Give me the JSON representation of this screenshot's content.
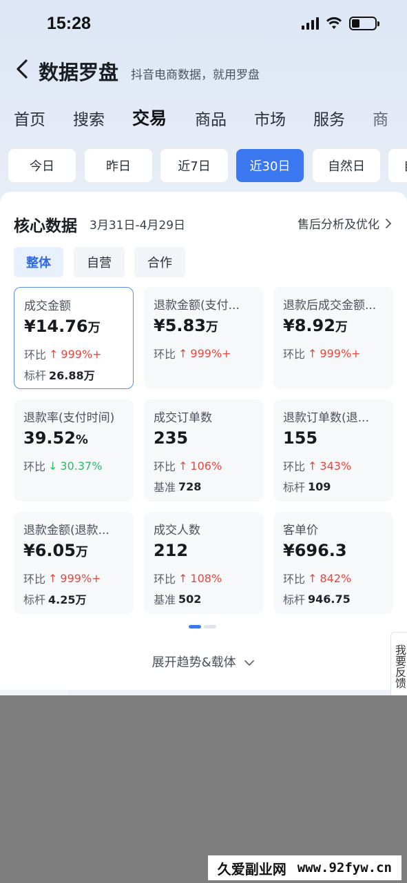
{
  "status_bar": {
    "time": "15:28"
  },
  "header": {
    "title": "数据罗盘",
    "subtitle": "抖音电商数据，就用罗盘"
  },
  "tabs": [
    {
      "label": "首页"
    },
    {
      "label": "搜索"
    },
    {
      "label": "交易"
    },
    {
      "label": "商品"
    },
    {
      "label": "市场"
    },
    {
      "label": "服务"
    },
    {
      "label": "商"
    }
  ],
  "active_tab": "交易",
  "date_filters": [
    {
      "label": "今日"
    },
    {
      "label": "昨日"
    },
    {
      "label": "近7日"
    },
    {
      "label": "近30日"
    },
    {
      "label": "自然日"
    },
    {
      "label": "自"
    }
  ],
  "active_date": "近30日",
  "core": {
    "title": "核心数据",
    "range": "3月31日-4月29日",
    "link": "售后分析及优化",
    "segments": [
      {
        "label": "整体"
      },
      {
        "label": "自营"
      },
      {
        "label": "合作"
      }
    ]
  },
  "metrics": [
    {
      "label": "成交金额",
      "value": "¥14.76",
      "unit": "万",
      "cmp_label": "环比",
      "cmp_dir": "up",
      "cmp_arrow": "↑",
      "cmp_value": "999%+",
      "bench_label": "标杆",
      "bench_value": "26.88万"
    },
    {
      "label": "退款金额(支付...",
      "value": "¥5.83",
      "unit": "万",
      "cmp_label": "环比",
      "cmp_dir": "up",
      "cmp_arrow": "↑",
      "cmp_value": "999%+",
      "bench_label": "",
      "bench_value": ""
    },
    {
      "label": "退款后成交金额...",
      "value": "¥8.92",
      "unit": "万",
      "cmp_label": "环比",
      "cmp_dir": "up",
      "cmp_arrow": "↑",
      "cmp_value": "999%+",
      "bench_label": "",
      "bench_value": ""
    },
    {
      "label": "退款率(支付时间)",
      "value": "39.52",
      "unit": "%",
      "cmp_label": "环比",
      "cmp_dir": "down",
      "cmp_arrow": "↓",
      "cmp_value": "30.37%",
      "bench_label": "",
      "bench_value": ""
    },
    {
      "label": "成交订单数",
      "value": "235",
      "unit": "",
      "cmp_label": "环比",
      "cmp_dir": "up",
      "cmp_arrow": "↑",
      "cmp_value": "106%",
      "bench_label": "基准",
      "bench_value": "728"
    },
    {
      "label": "退款订单数(退...",
      "value": "155",
      "unit": "",
      "cmp_label": "环比",
      "cmp_dir": "up",
      "cmp_arrow": "↑",
      "cmp_value": "343%",
      "bench_label": "标杆",
      "bench_value": "109"
    },
    {
      "label": "退款金额(退款...",
      "value": "¥6.05",
      "unit": "万",
      "cmp_label": "环比",
      "cmp_dir": "up",
      "cmp_arrow": "↑",
      "cmp_value": "999%+",
      "bench_label": "标杆",
      "bench_value": "4.25万"
    },
    {
      "label": "成交人数",
      "value": "212",
      "unit": "",
      "cmp_label": "环比",
      "cmp_dir": "up",
      "cmp_arrow": "↑",
      "cmp_value": "108%",
      "bench_label": "基准",
      "bench_value": "502"
    },
    {
      "label": "客单价",
      "value": "¥696.3",
      "unit": "",
      "cmp_label": "环比",
      "cmp_dir": "up",
      "cmp_arrow": "↑",
      "cmp_value": "842%",
      "bench_label": "标杆",
      "bench_value": "946.75"
    }
  ],
  "expand_label": "展开趋势&载体",
  "feedback_label": "我要反馈",
  "watermark": {
    "cn": "久爱副业网",
    "url": "www.92fyw.cn"
  },
  "colors": {
    "accent": "#3b78f0",
    "up": "#e0493f",
    "down": "#2fb866"
  }
}
